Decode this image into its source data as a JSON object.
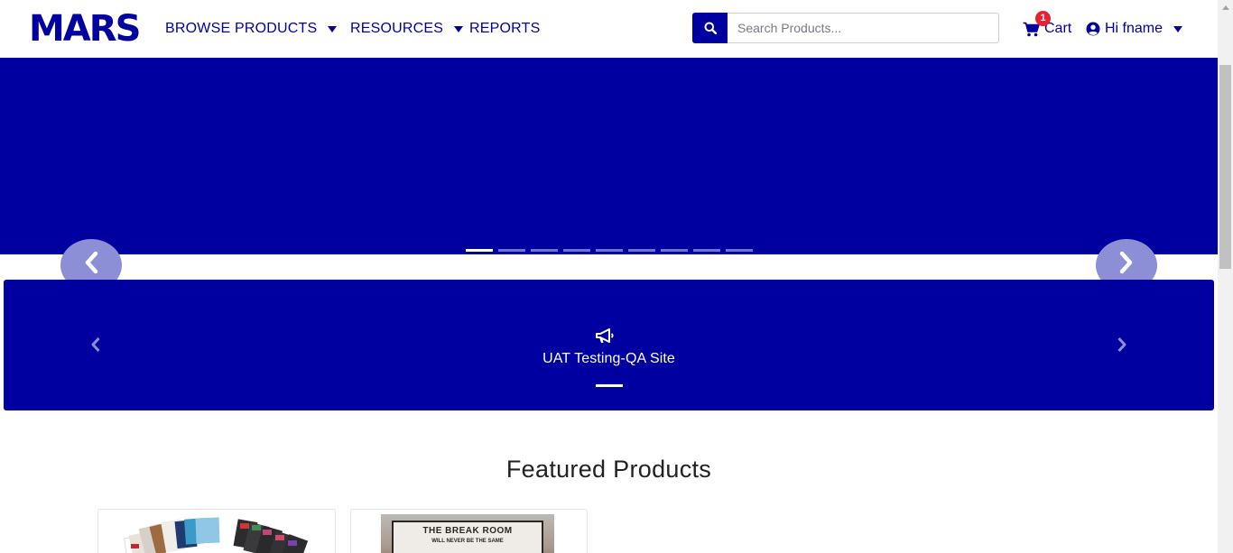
{
  "brand": {
    "logo_text": "MARS",
    "primary_color": "#0000a0",
    "accent_color": "#8d8fd6",
    "badge_color": "#e8202f"
  },
  "nav": {
    "browse_products": "BROWSE PRODUCTS",
    "resources": "RESOURCES",
    "reports": "REPORTS"
  },
  "search": {
    "placeholder": "Search Products...",
    "value": ""
  },
  "cart": {
    "label": "Cart",
    "count": "1"
  },
  "user": {
    "greeting": "Hi fname"
  },
  "hero": {
    "slide_count": 9,
    "active_slide": 1
  },
  "announcement": {
    "text": "UAT Testing-QA Site"
  },
  "featured": {
    "title": "Featured Products"
  },
  "cards": [
    {
      "image": "product-assortment-image"
    },
    {
      "image": "break-room-sign-image",
      "sign_text": "THE BREAK ROOM",
      "sign_subtext": "WILL NEVER BE THE SAME"
    }
  ]
}
